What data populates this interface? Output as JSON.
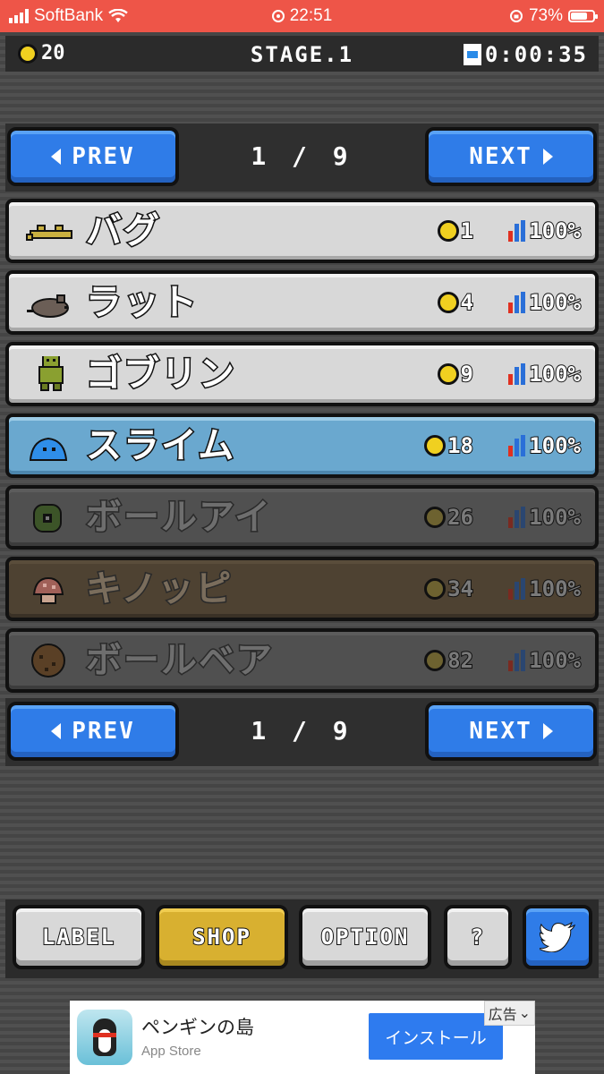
{
  "status_bar": {
    "carrier": "SoftBank",
    "time": "22:51",
    "battery": "73%"
  },
  "hud": {
    "coins": "20",
    "stage": "STAGE.1",
    "timer": "0:00:35"
  },
  "pager": {
    "prev_label": "PREV",
    "next_label": "NEXT",
    "page": "1 / 9"
  },
  "monsters": [
    {
      "name": "バグ",
      "reward": "1",
      "rate": "100%",
      "state": "unlocked",
      "sprite": "bug"
    },
    {
      "name": "ラット",
      "reward": "4",
      "rate": "100%",
      "state": "unlocked",
      "sprite": "rat"
    },
    {
      "name": "ゴブリン",
      "reward": "9",
      "rate": "100%",
      "state": "unlocked",
      "sprite": "goblin"
    },
    {
      "name": "スライム",
      "reward": "18",
      "rate": "100%",
      "state": "selected",
      "sprite": "slime"
    },
    {
      "name": "ボールアイ",
      "reward": "26",
      "rate": "100%",
      "state": "locked",
      "sprite": "ball-eye"
    },
    {
      "name": "キノッピ",
      "reward": "34",
      "rate": "100%",
      "state": "locked",
      "sprite": "mushroom"
    },
    {
      "name": "ボールベア",
      "reward": "82",
      "rate": "100%",
      "state": "locked",
      "sprite": "ball-bear"
    }
  ],
  "menu": {
    "label": "LABEL",
    "shop": "SHOP",
    "option": "OPTION",
    "help": "?"
  },
  "ad": {
    "title": "ペンギンの島",
    "store": "App Store",
    "install": "インストール",
    "tag": "広告"
  },
  "colors": {
    "status_bar": "#ee5548",
    "button_blue": "#2f7ce8",
    "button_gold": "#d8b030",
    "row_selected": "#6aa8cf",
    "coin": "#f0d020"
  }
}
